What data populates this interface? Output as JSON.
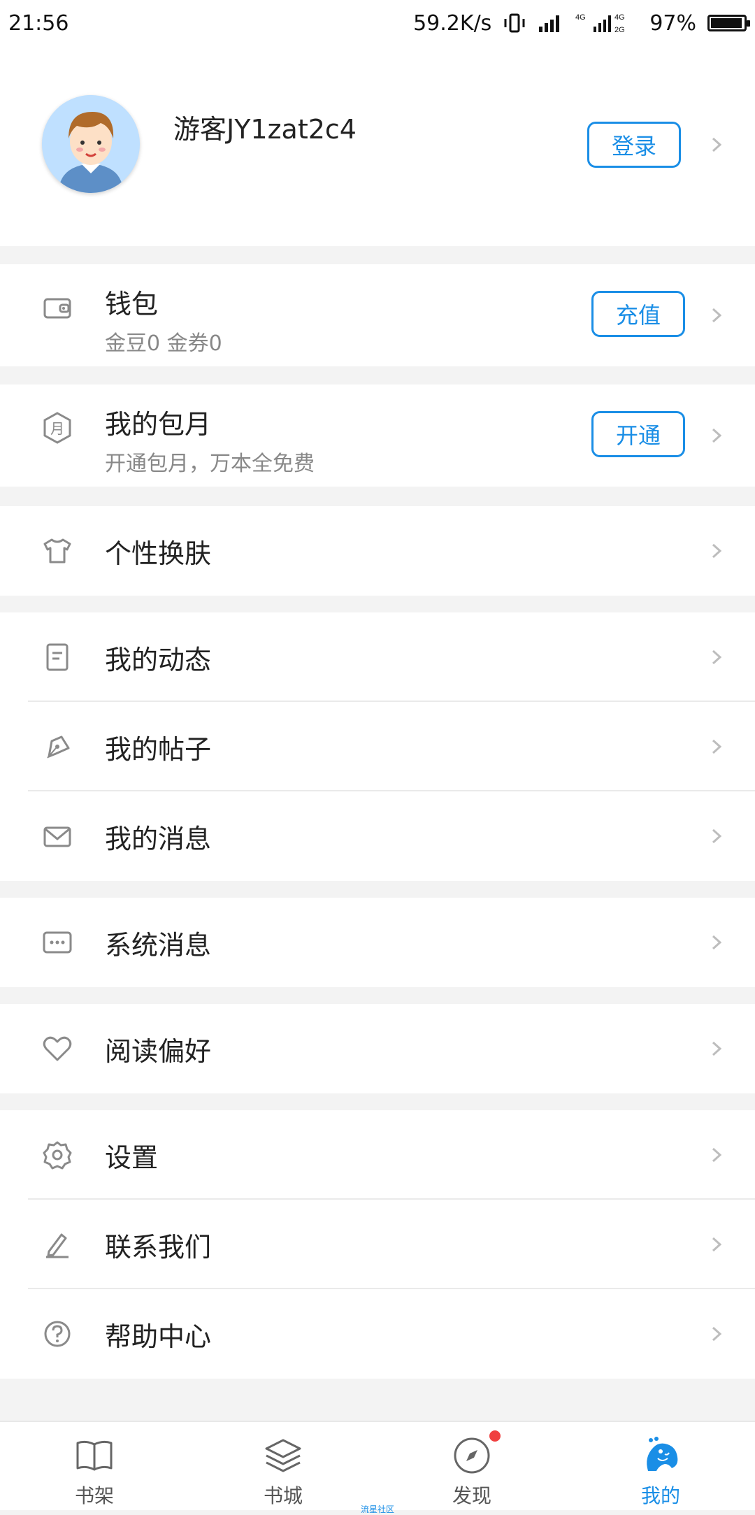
{
  "status": {
    "time": "21:56",
    "speed": "59.2K/s",
    "battery": "97%"
  },
  "profile": {
    "username": "游客JY1zat2c4",
    "login": "登录"
  },
  "wallet": {
    "title": "钱包",
    "sub": "金豆0 金券0",
    "button": "充值"
  },
  "monthly": {
    "title": "我的包月",
    "sub": "开通包月，万本全免费",
    "button": "开通"
  },
  "menu": {
    "skin": "个性换肤",
    "dynamic": "我的动态",
    "posts": "我的帖子",
    "messages": "我的消息",
    "system": "系统消息",
    "preference": "阅读偏好",
    "settings": "设置",
    "contact": "联系我们",
    "help": "帮助中心"
  },
  "tabs": [
    {
      "label": "书架"
    },
    {
      "label": "书城"
    },
    {
      "label": "发现"
    },
    {
      "label": "我的"
    }
  ],
  "footer_small": "流星社区",
  "accent": "#1a8ee6"
}
